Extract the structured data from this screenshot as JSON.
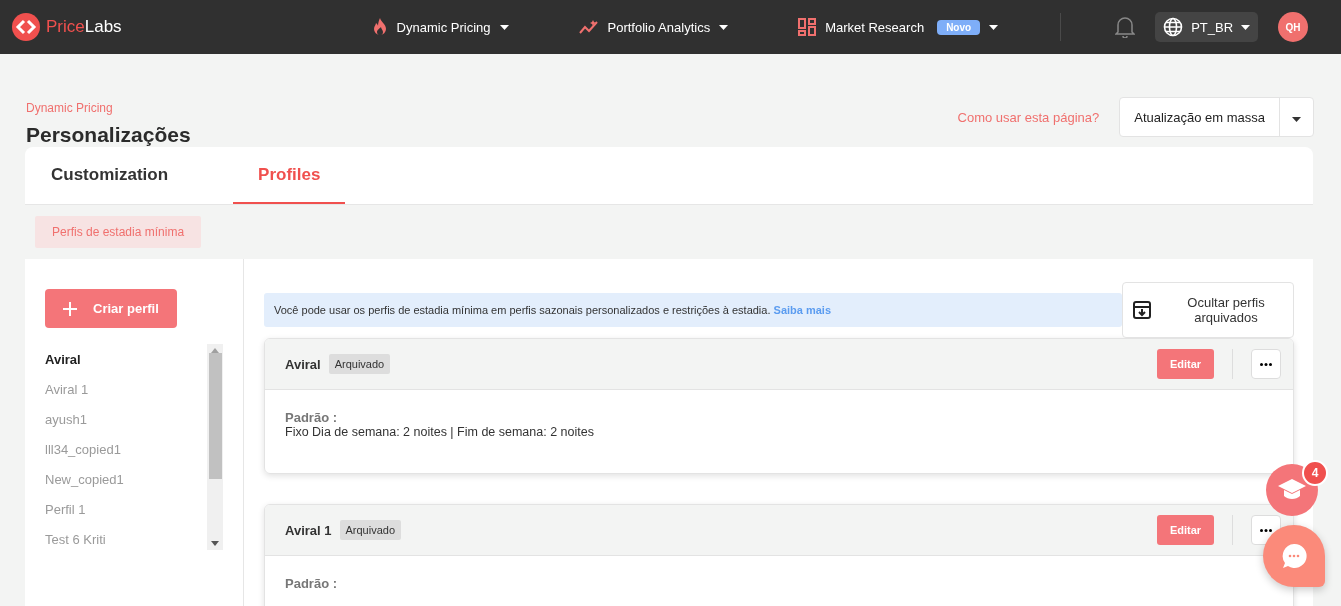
{
  "nav": {
    "brand_a": "Price",
    "brand_b": "Labs",
    "menus": [
      {
        "label": "Dynamic Pricing"
      },
      {
        "label": "Portfolio Analytics"
      },
      {
        "label": "Market Research",
        "badge": "Novo"
      }
    ],
    "language": "PT_BR",
    "avatar": "QH"
  },
  "breadcrumb": "Dynamic Pricing",
  "title": "Personalizações",
  "help_link": "Como usar esta página?",
  "bulk_button": "Atualização em massa",
  "tabs": [
    {
      "label": "Customization",
      "selected": false
    },
    {
      "label": "Profiles",
      "selected": true
    }
  ],
  "subtabs": [
    {
      "label": "Perfis de estadia mínima",
      "selected": true
    }
  ],
  "create_button": "Criar perfil",
  "profiles": [
    {
      "label": "Aviral",
      "selected": true
    },
    {
      "label": "Aviral 1",
      "selected": false
    },
    {
      "label": "ayush1",
      "selected": false
    },
    {
      "label": "lll34_copied1",
      "selected": false
    },
    {
      "label": "New_copied1",
      "selected": false
    },
    {
      "label": "Perfil 1",
      "selected": false
    },
    {
      "label": "Test 6 Kriti",
      "selected": false
    }
  ],
  "info": {
    "text": "Você pode usar os perfis de estadia mínima em perfis sazonais personalizados e restrições à estadia.",
    "link": "Saiba mais"
  },
  "hide_archived_button": "Ocultar perfis arquivados",
  "cards": [
    {
      "name": "Aviral",
      "tag": "Arquivado",
      "edit": "Editar",
      "label": "Padrão :",
      "detail": "Fixo Dia de semana: 2 noites | Fim de semana: 2 noites"
    },
    {
      "name": "Aviral 1",
      "tag": "Arquivado",
      "edit": "Editar",
      "label": "Padrão :"
    }
  ],
  "tutorial_badge": "4"
}
